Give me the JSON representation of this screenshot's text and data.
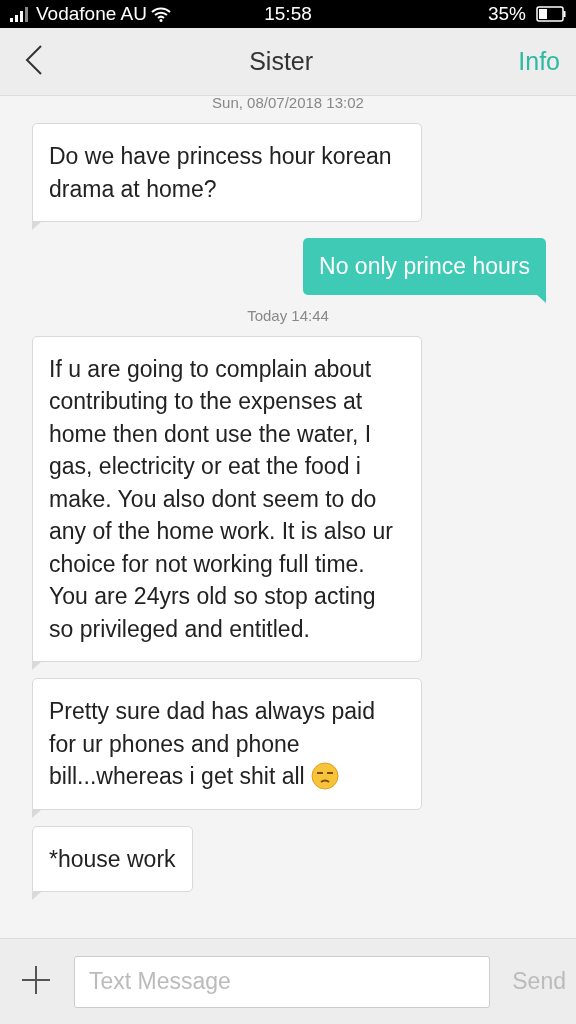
{
  "status_bar": {
    "carrier": "Vodafone AU",
    "time": "15:58",
    "battery": "35%"
  },
  "header": {
    "title": "Sister",
    "action": "Info"
  },
  "messages": [
    {
      "kind": "timestamp",
      "text": "Sun, 08/07/2018 13:02"
    },
    {
      "kind": "incoming",
      "text": "Do we have princess hour korean drama at home?"
    },
    {
      "kind": "outgoing",
      "text": "No only prince hours"
    },
    {
      "kind": "timestamp",
      "text": "Today  14:44"
    },
    {
      "kind": "incoming",
      "text": "If u are going to complain about contributing to the expenses at home then dont use the water, I gas, electricity or eat the food i make. You also dont seem to do any of the home work. It is also ur choice for not working full time. You are 24yrs old so stop acting so  privileged and entitled."
    },
    {
      "kind": "incoming",
      "text": "Pretty sure dad has always paid for ur phones and phone bill...whereas i get shit all",
      "emoji": true
    },
    {
      "kind": "incoming",
      "text": "*house work"
    }
  ],
  "composer": {
    "placeholder": "Text Message",
    "send": "Send"
  }
}
